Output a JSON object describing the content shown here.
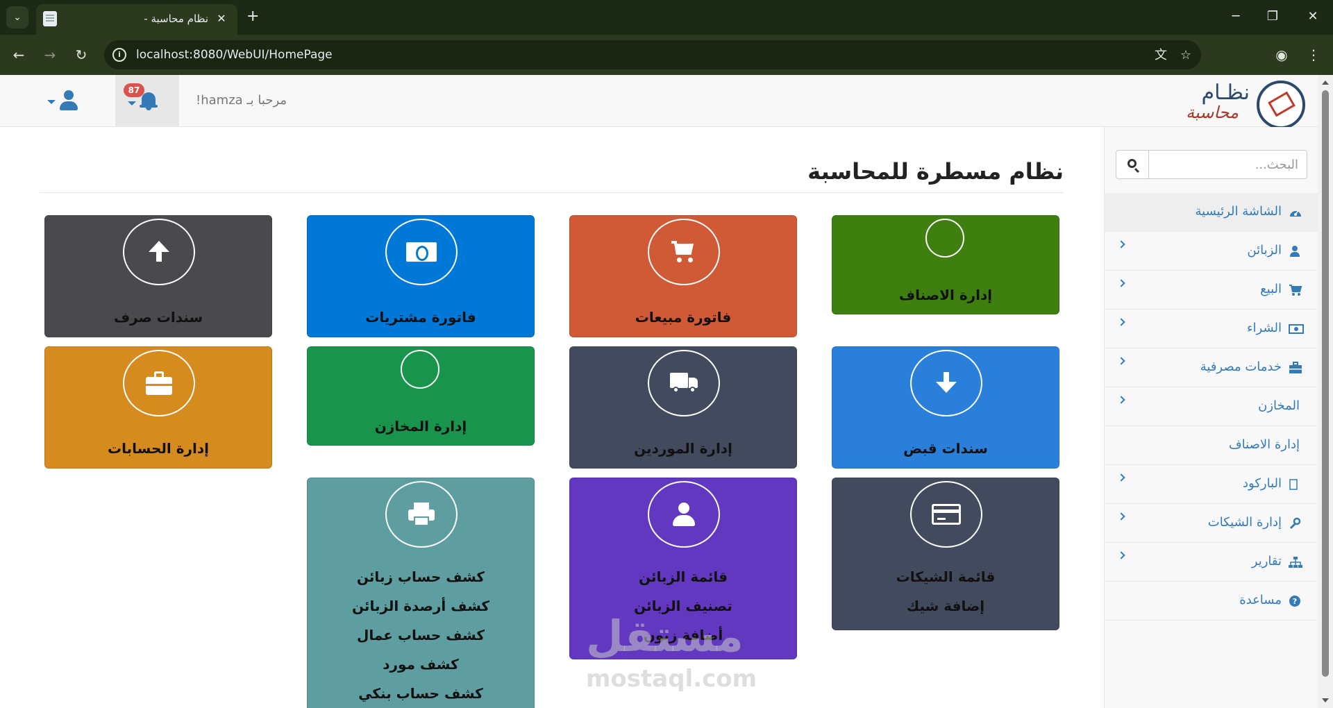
{
  "browser": {
    "tab_title": "نظام محاسبة -",
    "url": "localhost:8080/WebUI/HomePage"
  },
  "header": {
    "welcome": "مرحبا بـ hamza!",
    "notifications_count": "87"
  },
  "logo": {
    "line1": "نظـام",
    "line2": "محاسبة"
  },
  "sidebar": {
    "search_placeholder": "البحث...",
    "items": [
      {
        "label": "الشاشة الرئيسية",
        "icon": "dashboard-icon",
        "active": true,
        "chevron": false
      },
      {
        "label": "الزبائن",
        "icon": "user-icon",
        "chevron": true
      },
      {
        "label": "البيع",
        "icon": "cart-icon",
        "chevron": true
      },
      {
        "label": "الشراء",
        "icon": "money-icon",
        "chevron": true
      },
      {
        "label": "خدمات مصرفية",
        "icon": "briefcase-icon",
        "chevron": true
      },
      {
        "label": "المخازن",
        "icon": "",
        "chevron": true
      },
      {
        "label": "إدارة الاصناف",
        "icon": "",
        "chevron": false
      },
      {
        "label": "الباركود",
        "icon": "barcode-icon",
        "chevron": true
      },
      {
        "label": "إدارة الشيكات",
        "icon": "wrench-icon",
        "chevron": true
      },
      {
        "label": "تقارير",
        "icon": "sitemap-icon",
        "chevron": true
      },
      {
        "label": "مساعدة",
        "icon": "question-icon",
        "chevron": false
      }
    ]
  },
  "main": {
    "page_title": "نظام مسطرة للمحاسبة",
    "cards": [
      {
        "title": "إدارة الاصناف",
        "color": "#3e7f10",
        "icon": "empty-icon"
      },
      {
        "title": "فاتورة مبيعات",
        "color": "#d05a35",
        "icon": "cart-icon"
      },
      {
        "title": "فاتورة مشتريات",
        "color": "#0078d7",
        "icon": "money-icon"
      },
      {
        "title": "سندات صرف",
        "color": "#4a4a4e",
        "icon": "arrow-up-icon"
      },
      {
        "title": "سندات قبض",
        "color": "#2a7fdb",
        "icon": "arrow-down-icon"
      },
      {
        "title": "إدارة الموردين",
        "color": "#424a5d",
        "icon": "truck-icon"
      },
      {
        "title": "إدارة المخازن",
        "color": "#18944c",
        "icon": "empty-icon"
      },
      {
        "title": "إدارة الحسابات",
        "color": "#d68b1e",
        "icon": "briefcase-icon"
      },
      {
        "title": "",
        "color": "#424a5d",
        "icon": "credit-card-icon",
        "links": [
          "قائمة الشيكات",
          "إضافة شيك"
        ]
      },
      {
        "title": "",
        "color": "#6238c1",
        "icon": "user-icon",
        "links": [
          "قائمة الزبائن",
          "تصنيف الزبائن",
          "أضافة زبون"
        ]
      },
      {
        "title": "",
        "color": "#5f9ea0",
        "icon": "print-icon",
        "links": [
          "كشف حساب زبائن",
          "كشف أرصدة الزبائن",
          "كشف حساب عمال",
          "كشف مورد",
          "كشف حساب بنكي"
        ]
      }
    ]
  },
  "watermark": {
    "arabic": "مستقل",
    "latin": "mostaql.com"
  }
}
